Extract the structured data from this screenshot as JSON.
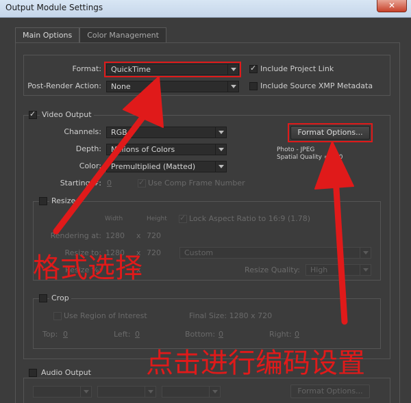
{
  "window": {
    "title": "Output Module Settings",
    "close_glyph": "✕"
  },
  "tabs": [
    {
      "label": "Main Options",
      "active": true
    },
    {
      "label": "Color Management",
      "active": false
    }
  ],
  "format_section": {
    "format_label": "Format:",
    "format_value": "QuickTime",
    "post_render_label": "Post-Render Action:",
    "post_render_value": "None",
    "include_project_link": {
      "label": "Include Project Link",
      "checked": true
    },
    "include_xmp": {
      "label": "Include Source XMP Metadata",
      "checked": false
    }
  },
  "video_output": {
    "label": "Video Output",
    "checked": true,
    "channels_label": "Channels:",
    "channels_value": "RGB",
    "depth_label": "Depth:",
    "depth_value": "Millions of Colors",
    "color_label": "Color:",
    "color_value": "Premultiplied (Matted)",
    "starting_label": "Starting #:",
    "starting_value": "0",
    "use_comp_frame": {
      "label": "Use Comp Frame Number",
      "checked": true
    },
    "format_options_button": "Format Options...",
    "format_info_line1": "Photo - JPEG",
    "format_info_line2": "Spatial Quality = 100"
  },
  "resize": {
    "label": "Resize",
    "checked": false,
    "width_header": "Width",
    "height_header": "Height",
    "lock_aspect": {
      "label": "Lock Aspect Ratio to 16:9 (1.78)",
      "checked": true
    },
    "rendering_at_label": "Rendering at:",
    "rendering_w": "1280",
    "rendering_x": "x",
    "rendering_h": "720",
    "resize_to_label": "Resize to:",
    "resize_to_w": "1280",
    "resize_to_x": "x",
    "resize_to_h": "720",
    "resize_preset": "Custom",
    "resize_pct_label": "Resize %:",
    "resize_pct_x": "x",
    "resize_quality_label": "Resize Quality:",
    "resize_quality_value": "High"
  },
  "crop": {
    "label": "Crop",
    "checked": false,
    "use_roi": {
      "label": "Use Region of Interest",
      "checked": false
    },
    "final_size": "Final Size: 1280 x 720",
    "top_label": "Top:",
    "top_value": "0",
    "left_label": "Left:",
    "left_value": "0",
    "bottom_label": "Bottom:",
    "bottom_value": "0",
    "right_label": "Right:",
    "right_value": "0"
  },
  "audio_output": {
    "label": "Audio Output",
    "checked": false,
    "format_options_button": "Format Options..."
  },
  "annotations": {
    "format_select": "格式选择",
    "encoding_settings": "点击进行编码设置",
    "color": "#e01a1a"
  }
}
